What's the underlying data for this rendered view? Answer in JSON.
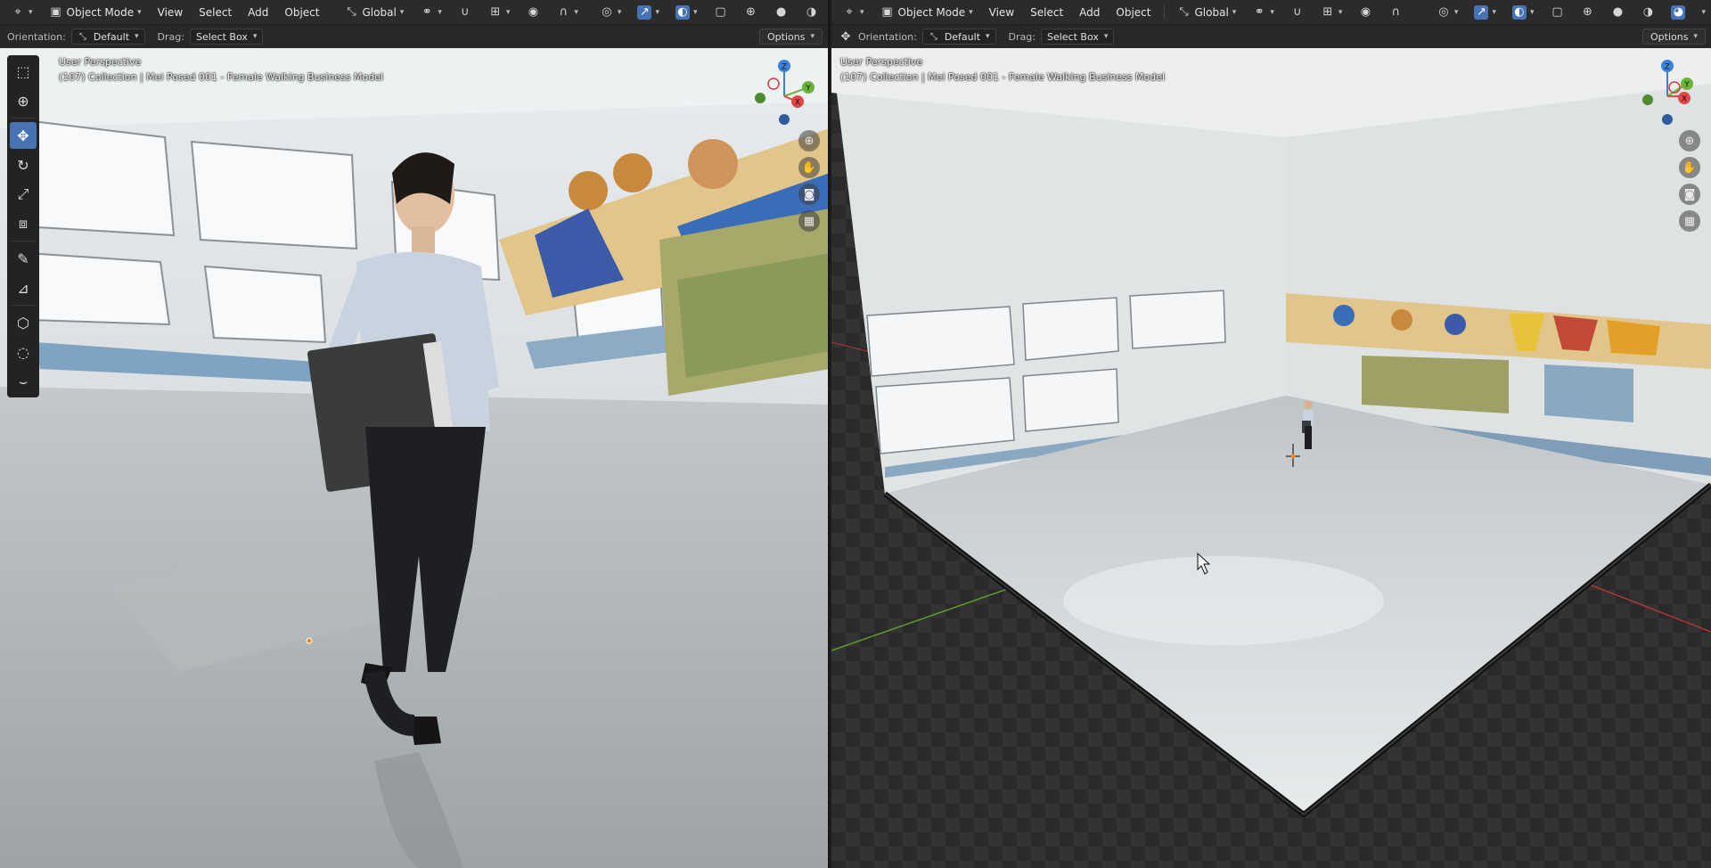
{
  "colors": {
    "accent": "#4772b3",
    "header_bg": "#2b2b2b",
    "axis_x": "#e04848",
    "axis_y": "#6cb23a",
    "axis_z": "#3d82d6"
  },
  "left_viewport": {
    "header": {
      "editor_icon": "3d-viewport-icon",
      "mode": "Object Mode",
      "menus": [
        "View",
        "Select",
        "Add",
        "Object"
      ],
      "transform_orientation": "Global"
    },
    "tool_settings": {
      "orientation_label": "Orientation:",
      "orientation_value": "Default",
      "drag_label": "Drag:",
      "drag_value": "Select Box",
      "options_label": "Options"
    },
    "overlay": {
      "view_name": "User Perspective",
      "object_info": "(107) Collection | Mei Posed 001 - Female Walking Business Model"
    },
    "gizmo_labels": {
      "x": "X",
      "y": "Y",
      "z": "Z"
    }
  },
  "right_viewport": {
    "header": {
      "editor_icon": "3d-viewport-icon",
      "mode": "Object Mode",
      "menus": [
        "View",
        "Select",
        "Add",
        "Object"
      ],
      "transform_orientation": "Global"
    },
    "tool_settings": {
      "orientation_label": "Orientation:",
      "orientation_value": "Default",
      "drag_label": "Drag:",
      "drag_value": "Select Box",
      "options_label": "Options"
    },
    "overlay": {
      "view_name": "User Perspective",
      "object_info": "(107) Collection | Mei Posed 001 - Female Walking Business Model"
    },
    "gizmo_labels": {
      "x": "X",
      "y": "Y",
      "z": "Z"
    }
  },
  "toolbar_tools": [
    "select-box-tool",
    "cursor-tool",
    "move-tool",
    "rotate-tool",
    "scale-tool",
    "transform-tool",
    "annotate-tool",
    "measure-tool",
    "add-cube-tool",
    "shear-tool",
    "curve-tool"
  ],
  "active_tool": "move-tool"
}
